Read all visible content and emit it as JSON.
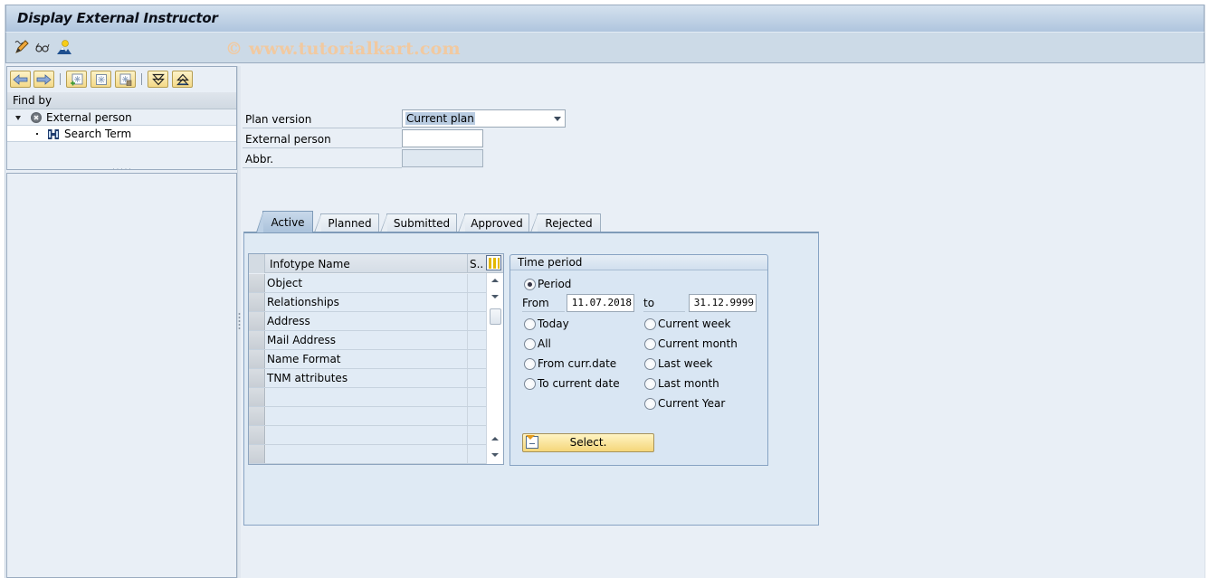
{
  "window": {
    "title": "Display External Instructor",
    "watermark": "© www.tutorialkart.com"
  },
  "toolbar": {
    "icons": [
      "change-icon",
      "display-icon",
      "create-icon"
    ]
  },
  "nav": {
    "buttons": [
      "back-arrow-icon",
      "forward-arrow-icon",
      "create-object-icon",
      "object-icon",
      "delete-object-icon",
      "expand-all-icon",
      "collapse-all-icon"
    ],
    "find_by_label": "Find by",
    "tree": [
      {
        "label": "External person",
        "icon": "external-person-icon",
        "expanded": true
      },
      {
        "label": "Search Term",
        "icon": "binoculars-icon"
      }
    ]
  },
  "form": {
    "plan_version_label": "Plan version",
    "plan_version_value": "Current plan",
    "external_person_label": "External person",
    "external_person_value": "",
    "abbr_label": "Abbr.",
    "abbr_value": ""
  },
  "tabs": [
    {
      "label": "Active",
      "active": true
    },
    {
      "label": "Planned",
      "active": false
    },
    {
      "label": "Submitted",
      "active": false
    },
    {
      "label": "Approved",
      "active": false
    },
    {
      "label": "Rejected",
      "active": false
    }
  ],
  "infotype_table": {
    "columns": [
      "Infotype Name",
      "S.."
    ],
    "rows": [
      "Object",
      "Relationships",
      "Address",
      "Mail Address",
      "Name Format",
      "TNM attributes",
      "",
      "",
      "",
      ""
    ]
  },
  "time_period": {
    "title": "Time period",
    "period_label": "Period",
    "from_label": "From",
    "from_value": "11.07.2018",
    "to_label": "to",
    "to_value": "31.12.9999",
    "left_options": [
      "Today",
      "All",
      "From curr.date",
      "To current date"
    ],
    "right_options": [
      "Current week",
      "Current month",
      "Last week",
      "Last month",
      "Current Year"
    ],
    "selected": "Period",
    "select_button": "Select."
  }
}
